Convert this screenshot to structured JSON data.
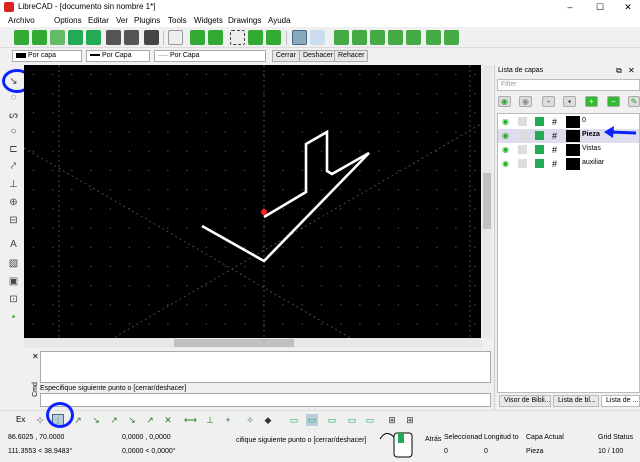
{
  "window": {
    "title": "LibreCAD - [documento sin nombre 1*]",
    "minimize": "–",
    "maximize": "☐",
    "close": "✕"
  },
  "menu": [
    "Archivo",
    "Options",
    "Editar",
    "Ver",
    "Plugins",
    "Tools",
    "Widgets",
    "Drawings",
    "Ayuda"
  ],
  "pen_toolbar": {
    "color_combo": "Por capa",
    "linetype_combo": "Por Capa",
    "width_combo": "Por Capa",
    "close_button": "Cerrar",
    "undo_button": "Deshacer",
    "redo_button": "Rehacer"
  },
  "command": {
    "close_glyph": "✕",
    "prompt": "Especifique siguiente punto o [cerrar/deshacer]",
    "panel_tab": "Cmd"
  },
  "layers": {
    "title": "Lista de capas",
    "filter_placeholder": "Filter",
    "items": [
      {
        "name": "0",
        "color": "#000000",
        "active": false
      },
      {
        "name": "Pieza",
        "color": "#000000",
        "active": true
      },
      {
        "name": "Vistas",
        "color": "#000000",
        "active": false
      },
      {
        "name": "auxiliar",
        "color": "#000000",
        "active": false
      }
    ]
  },
  "dock_tabs": [
    "Visor de Bibli...",
    "Lista de bl...",
    "Lista de ..."
  ],
  "snap_toolbar": {
    "label": "Ex"
  },
  "status": {
    "abs_coord": "86.6025 , 70.0000",
    "abs_polar": "111.3553 < 38.9483°",
    "rel_coord": "0,0000 , 0,0000",
    "rel_polar": "0,0000 < 0,0000°",
    "prompt": "cifique siguiente punto o [cerrar/deshacer]",
    "back_label": "Atrás",
    "selected_label": "Seleccionad",
    "selected_value": "0",
    "length_label": "Longitud to",
    "length_value": "0",
    "layer_label": "Capa Actual",
    "layer_value": "Pieza",
    "grid_label": "Grid Status",
    "grid_value": "10 / 100"
  },
  "colors": {
    "canvas": "#000000",
    "highlight": "#0a22ff",
    "ui": "#f0f0f0"
  }
}
